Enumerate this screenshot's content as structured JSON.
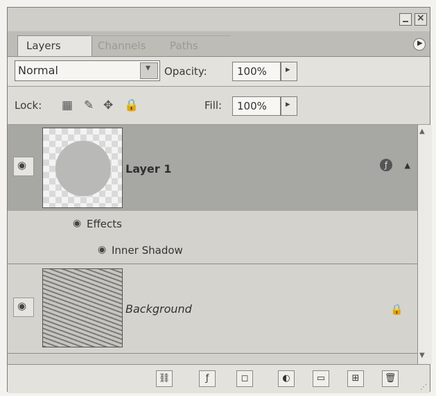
{
  "panel": {
    "tabs": [
      "Layers",
      "Channels",
      "Paths"
    ],
    "menu_icon": "menu-circle-arrow-icon",
    "window_buttons": [
      "minimize",
      "close"
    ]
  },
  "controls": {
    "blend_mode": "Normal",
    "opacity_label": "Opacity:",
    "opacity_value": "100%",
    "lock_label": "Lock:",
    "fill_label": "Fill:",
    "fill_value": "100%"
  },
  "layers": [
    {
      "name": "Layer 1",
      "visible": true,
      "effects_label": "Effects",
      "effect_name": "Inner Shadow"
    },
    {
      "name": "Background",
      "visible": true,
      "locked": true
    }
  ],
  "bottom_tools": [
    "link-icon",
    "layer-style-icon",
    "mask-icon",
    "adjustment-icon",
    "folder-icon",
    "new-layer-icon",
    "trash-icon"
  ]
}
